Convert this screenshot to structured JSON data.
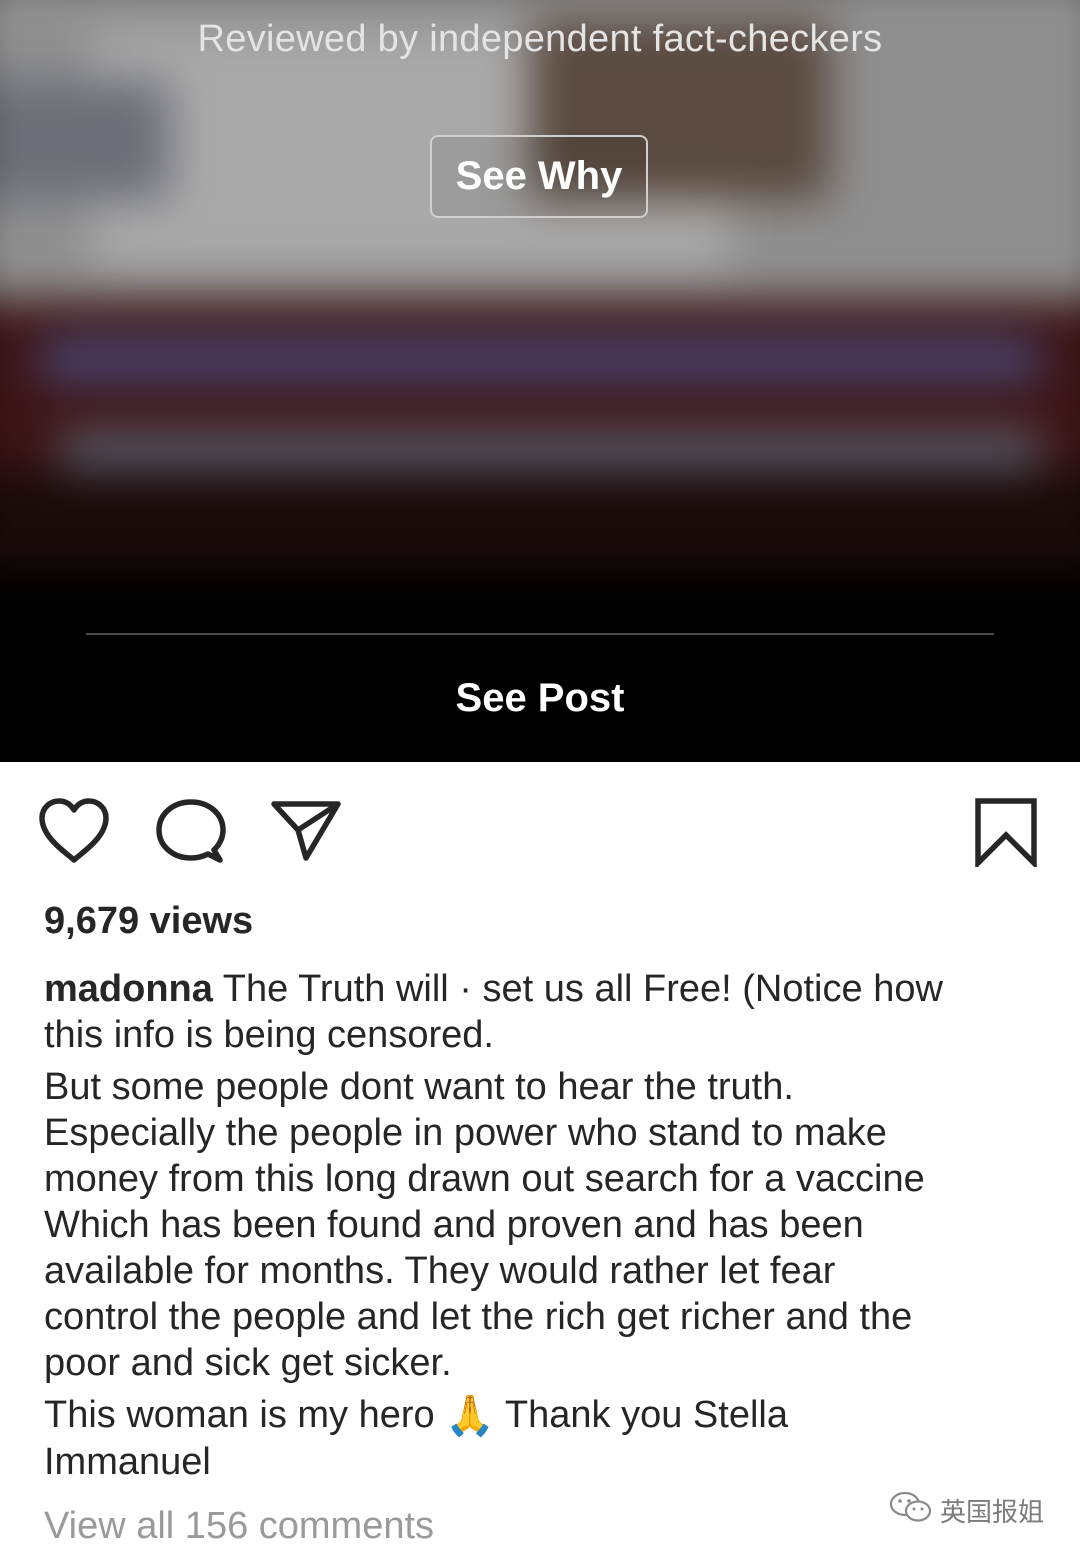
{
  "overlay": {
    "fact_check_note": "Reviewed by independent fact-checkers",
    "see_why_label": "See Why",
    "see_post_label": "See Post"
  },
  "actions": {
    "like_icon": "heart-icon",
    "comment_icon": "comment-icon",
    "share_icon": "send-icon",
    "save_icon": "bookmark-icon"
  },
  "stats": {
    "views_text": "9,679 views"
  },
  "caption": {
    "username": "madonna",
    "line1_rest": " The Truth will · set us all Free! (Notice how",
    "line2": "this info is being censored.",
    "line3": "But some people dont want to hear the truth.",
    "line4": "Especially the people in power who stand to make",
    "line5": "money from this long drawn out search for a vaccine",
    "line6": "Which has been found and proven and has been",
    "line7": "available for months.  They would rather let fear",
    "line8": "control the people  and let the rich get richer and the",
    "line9": "poor and sick get sicker.",
    "line10_a": "This woman is my hero ",
    "line10_emoji": "🙏",
    "line10_b": " Thank you Stella",
    "line11": "Immanuel"
  },
  "comments": {
    "view_all_label": "View all 156 comments"
  },
  "watermark": {
    "text": "英国报姐",
    "icon": "wechat-icon"
  },
  "colors": {
    "text": "#262626",
    "muted": "#9a9a9a",
    "media_bg": "#000000"
  }
}
